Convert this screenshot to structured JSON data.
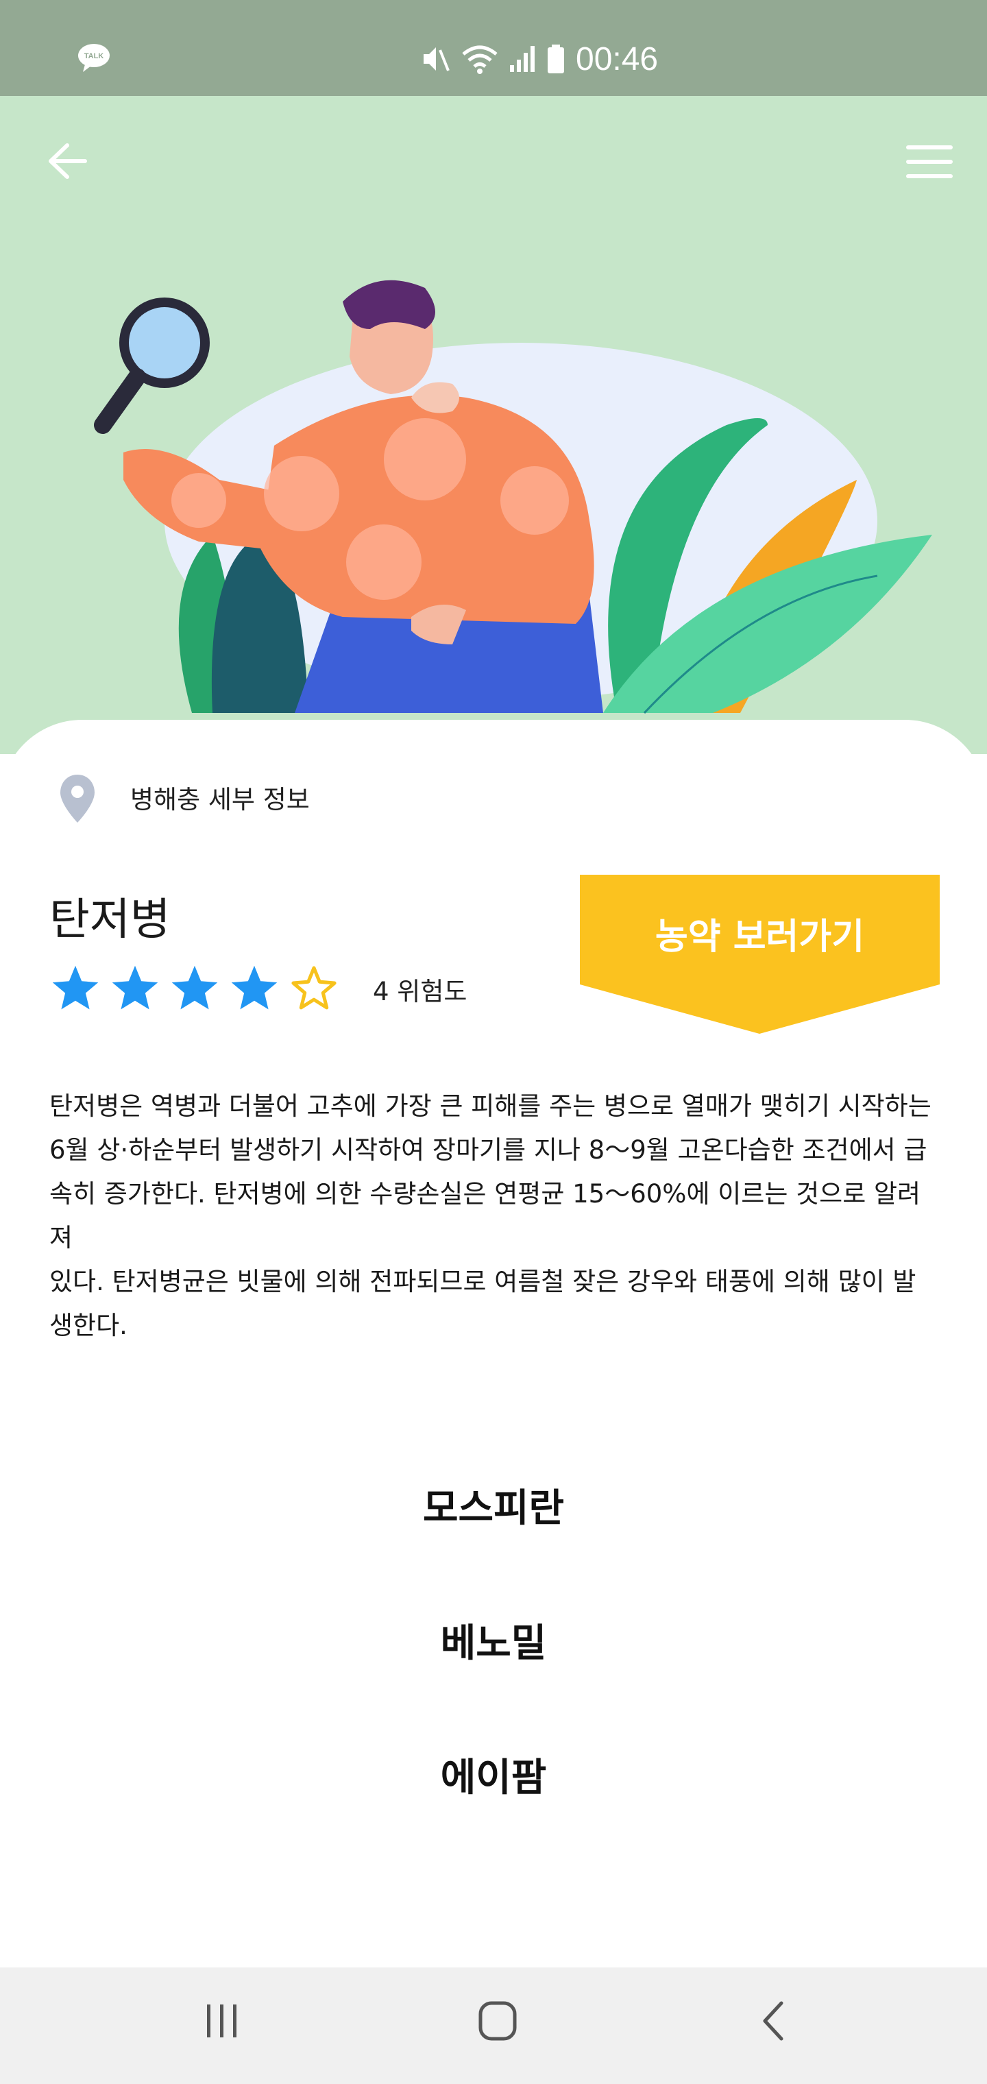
{
  "status_bar": {
    "time": "00:46",
    "icons": [
      "kakaotalk-icon",
      "mute-icon",
      "wifi-icon",
      "signal-icon",
      "battery-icon"
    ]
  },
  "header": {
    "back_icon": "arrow-left-icon",
    "menu_icon": "hamburger-menu-icon"
  },
  "detail": {
    "section_label": "병해충 세부 정보",
    "disease_name": "탄저병",
    "risk_level": 4,
    "risk_max": 5,
    "risk_label": "4 위험도",
    "pesticide_button": "농약 보러가기",
    "description_lines": [
      "탄저병은 역병과 더불어 고추에 가장 큰 피해를 주는 병으로 열매가 맺히기 시작하는",
      "6월 상·하순부터 발생하기 시작하여 장마기를 지나 8〜9월 고온다습한 조건에서 급",
      "속히 증가한다. 탄저병에 의한 수량손실은 연평균 15〜60%에 이르는 것으로 알려져",
      "있다. 탄저병균은 빗물에 의해 전파되므로 여름철 잦은 강우와 태풍에 의해 많이 발",
      "생한다."
    ]
  },
  "products": [
    "모스피란",
    "베노밀",
    "에이팜"
  ],
  "colors": {
    "status_bar": "#93a993",
    "hero_bg": "#c6e6c9",
    "star_blue": "#2196f3",
    "star_outline": "#f7c21c",
    "button_yellow": "#fbc21f"
  }
}
